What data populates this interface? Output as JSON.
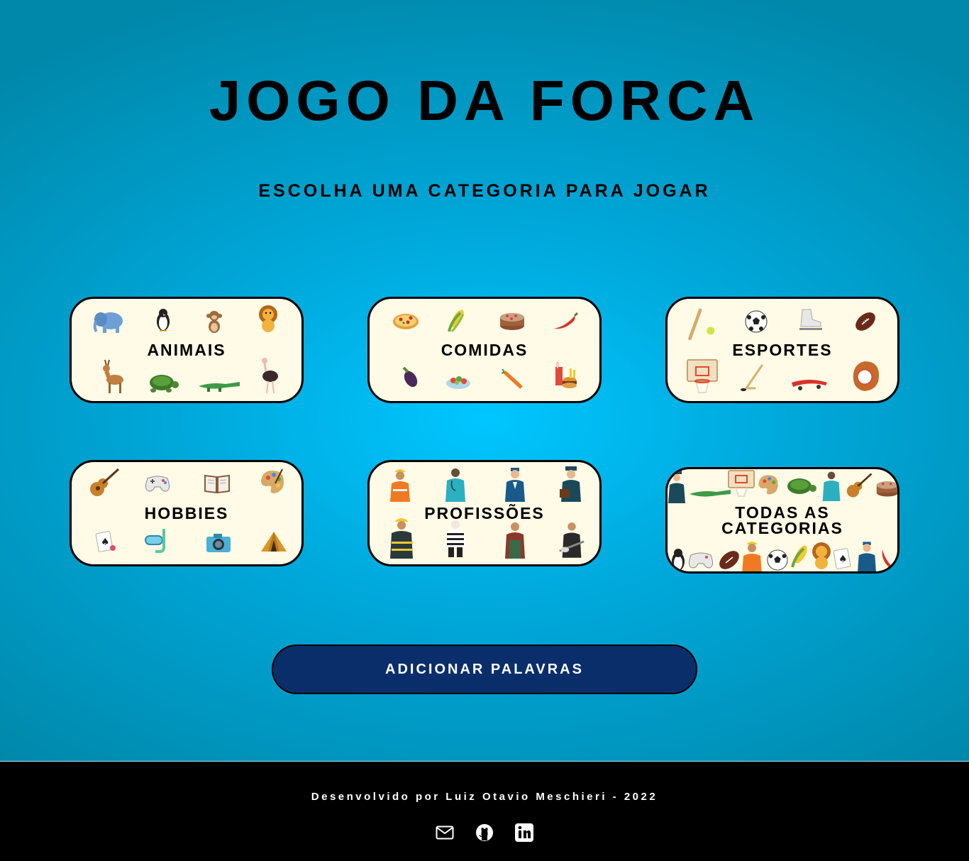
{
  "header": {
    "title": "JOGO DA FORCA",
    "subtitle": "ESCOLHA UMA CATEGORIA PARA JOGAR"
  },
  "categories": [
    {
      "label": "ANIMAIS",
      "icons": [
        "elephant-icon",
        "penguin-icon",
        "monkey-icon",
        "lion-icon",
        "deer-icon",
        "turtle-icon",
        "crocodile-icon",
        "ostrich-icon"
      ]
    },
    {
      "label": "COMIDAS",
      "icons": [
        "pizza-icon",
        "corn-icon",
        "cake-icon",
        "chili-pepper-icon",
        "eggplant-icon",
        "salad-icon",
        "carrot-icon",
        "fast-food-icon"
      ]
    },
    {
      "label": "ESPORTES",
      "icons": [
        "baseball-bat-icon",
        "soccer-ball-icon",
        "ice-skate-icon",
        "football-icon",
        "basketball-hoop-icon",
        "hockey-stick-icon",
        "skateboard-icon",
        "baseball-glove-icon"
      ]
    },
    {
      "label": "HOBBIES",
      "icons": [
        "guitar-icon",
        "game-controller-icon",
        "book-icon",
        "palette-icon",
        "playing-cards-icon",
        "snorkel-icon",
        "camera-icon",
        "tent-icon"
      ]
    },
    {
      "label": "PROFISSÕES",
      "icons": [
        "construction-worker-icon",
        "doctor-icon",
        "flight-attendant-icon",
        "pilot-icon",
        "firefighter-icon",
        "mime-icon",
        "farmer-icon",
        "musician-icon"
      ]
    },
    {
      "label_line1": "TODAS AS",
      "label_line2": "CATEGORIAS"
    }
  ],
  "actions": {
    "add_words_label": "ADICIONAR PALAVRAS"
  },
  "footer": {
    "credit": "Desenvolvido por Luiz Otavio Meschieri - 2022",
    "links": [
      "email-icon",
      "github-icon",
      "linkedin-icon"
    ]
  },
  "colors": {
    "background_center": "#00c6ff",
    "background_edge": "#0088aa",
    "card_fill": "#fffbe6",
    "button_fill": "#0a2e6a",
    "footer": "#000000"
  }
}
